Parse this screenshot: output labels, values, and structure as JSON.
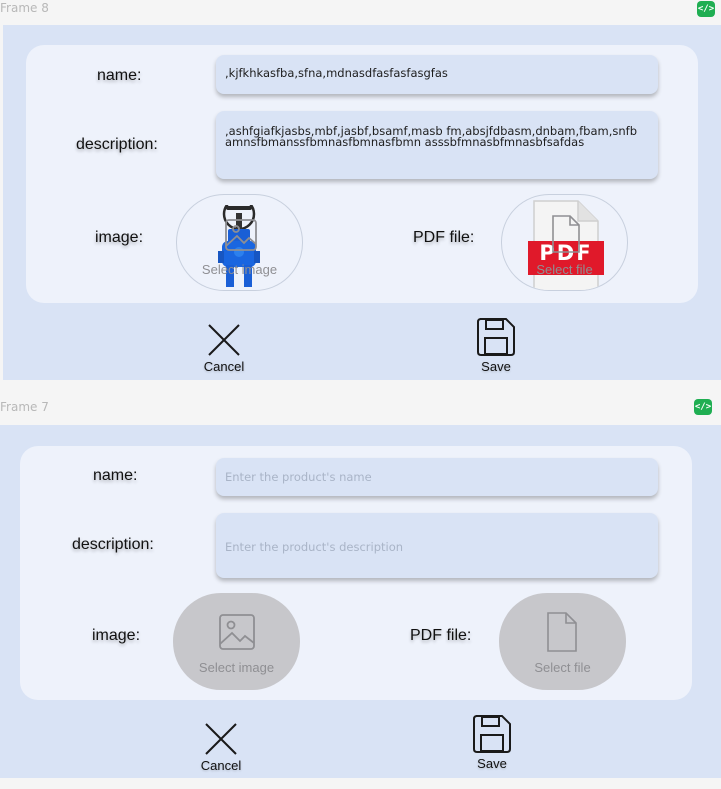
{
  "frames": [
    {
      "label": "Frame 8",
      "badge": "</>",
      "name_label": "name:",
      "name_value": ",kjfkhkasfba,sfna,mdnasdfasfasfasgfas",
      "description_label": "description:",
      "description_value": ",ashfgiafkjasbs,mbf,jasbf,bsamf,masb fm,absjfdbasm,dnbam,fbam,snfbamnsfbmanssfbmnasfbmnasfbmn asssbfmnasbfmnasbfsafdas",
      "image_label": "image:",
      "image_button": "Select image",
      "pdf_label": "PDF file:",
      "pdf_button": "Select file",
      "pdf_badge": "PDF",
      "cancel": "Cancel",
      "save": "Save"
    },
    {
      "label": "Frame 7",
      "badge": "</>",
      "name_label": "name:",
      "name_placeholder": "Enter the product's name",
      "description_label": "description:",
      "description_placeholder": "Enter the product's description",
      "image_label": "image:",
      "image_button": "Select image",
      "pdf_label": "PDF file:",
      "pdf_button": "Select file",
      "cancel": "Cancel",
      "save": "Save"
    }
  ]
}
